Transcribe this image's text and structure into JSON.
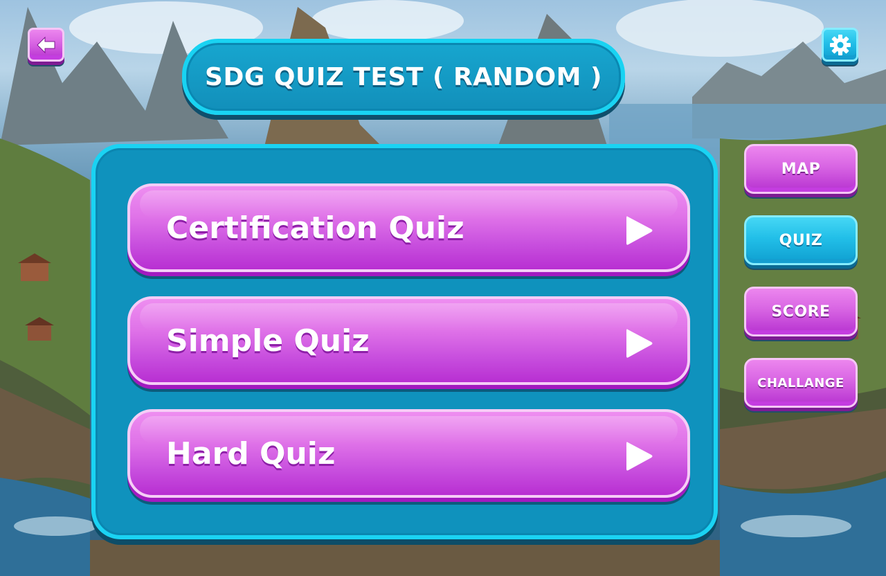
{
  "header": {
    "title": "SDG QUIZ TEST ( RANDOM )",
    "back_icon": "back-arrow-icon",
    "settings_icon": "gear-icon"
  },
  "quiz_options": [
    {
      "label": "Certification Quiz",
      "icon": "play-icon"
    },
    {
      "label": "Simple Quiz",
      "icon": "play-icon"
    },
    {
      "label": "Hard Quiz",
      "icon": "play-icon"
    }
  ],
  "side_nav": {
    "items": [
      {
        "label": "MAP",
        "active": false
      },
      {
        "label": "QUIZ",
        "active": true
      },
      {
        "label": "SCORE",
        "active": false
      },
      {
        "label": "CHALLANGE",
        "active": false
      }
    ]
  },
  "colors": {
    "panel_blue": "#0f92bd",
    "panel_border_cyan": "#1ad3f3",
    "button_pink": "#d865e3",
    "active_cyan": "#22bfe8"
  }
}
